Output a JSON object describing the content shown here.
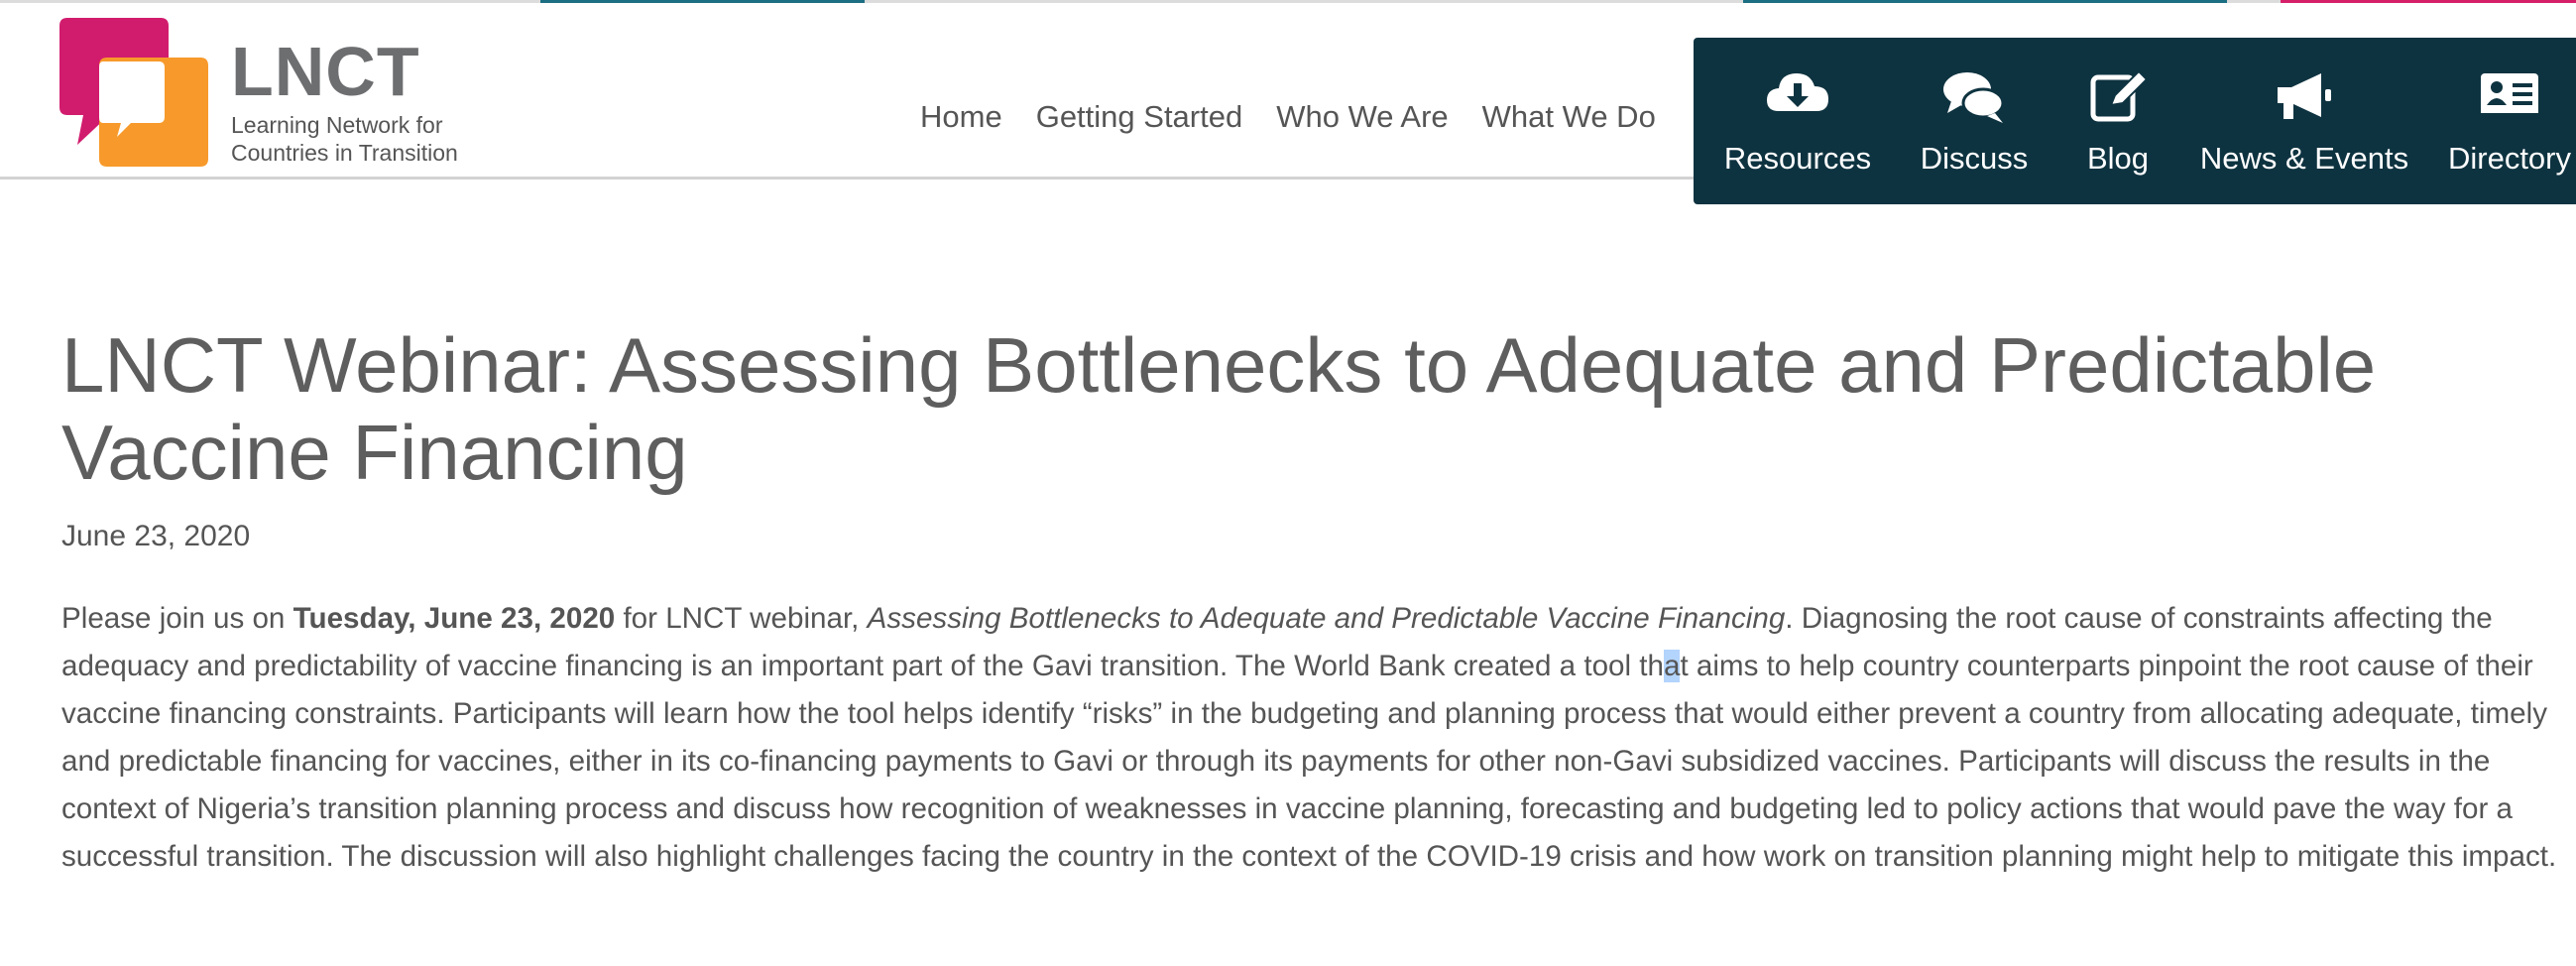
{
  "logo": {
    "title": "LNCT",
    "subtitle_line1": "Learning Network for",
    "subtitle_line2": "Countries in Transition",
    "icon": "speech-bubbles-logo-icon"
  },
  "top_nav": {
    "items": [
      "Home",
      "Getting Started",
      "Who We Are",
      "What We Do"
    ]
  },
  "dark_nav": {
    "items": [
      {
        "label": "Resources",
        "icon": "cloud-download-icon"
      },
      {
        "label": "Discuss",
        "icon": "chat-bubbles-icon"
      },
      {
        "label": "Blog",
        "icon": "edit-icon"
      },
      {
        "label": "News & Events",
        "icon": "megaphone-icon"
      },
      {
        "label": "Directory",
        "icon": "contact-card-icon"
      }
    ]
  },
  "article": {
    "title": "LNCT Webinar: Assessing Bottlenecks to Adequate and Predictable Vaccine Financing",
    "date": "June 23, 2020",
    "p_intro": "Please join us on ",
    "p_bold": "Tuesday, June 23, 2020",
    "p_mid": " for LNCT webinar, ",
    "p_italic": "Assessing Bottlenecks to Adequate and Predictable Vaccine Financing",
    "p_rest_a": ". Diagnosing the root cause of constraints affecting the adequacy and predictability of vaccine financing is an important part of the Gavi transition. The World Bank created a tool th",
    "p_highlight": "a",
    "p_rest_b": "t aims to help country counterparts pinpoint the root cause of their vaccine financing constraints. Participants will learn how the tool helps identify “risks” in the budgeting and planning process that would either prevent a country from allocating adequate, timely and predictable financing for vaccines, either in its co-financing payments to Gavi or through its payments for other non-Gavi subsidized vaccines. Participants will discuss the results in the context of Nigeria’s transition planning process and discuss how recognition of weaknesses in vaccine planning, forecasting and budgeting led to policy actions that would pave the way for a successful transition. The discussion will also highlight challenges facing the country in the context of the COVID-19 crisis and how work on transition planning might help to mitigate this impact."
  },
  "colors": {
    "dark_nav_bg": "#0e3340",
    "logo_magenta": "#d11c6e",
    "logo_orange": "#f79a2b",
    "strip_teal": "#1c6e82",
    "strip_magenta": "#d61f69",
    "selection": "#b3d4fc"
  }
}
